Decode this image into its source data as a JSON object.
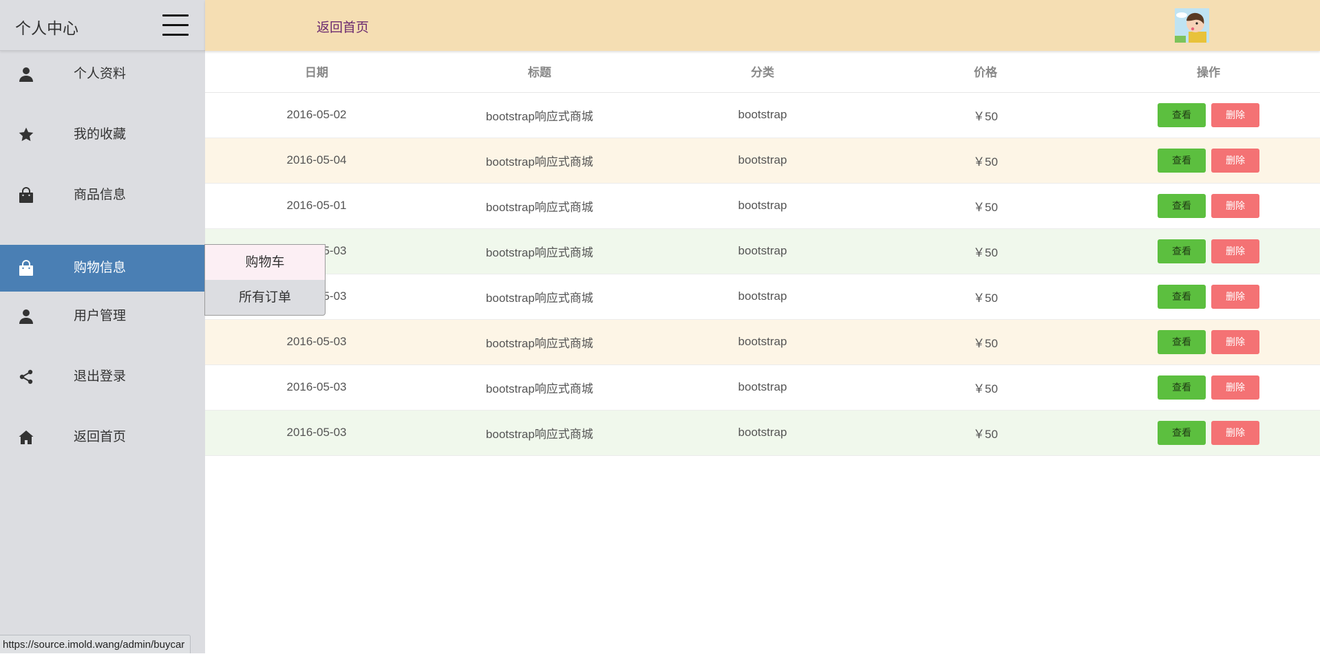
{
  "sidebar": {
    "title": "个人中心",
    "items": [
      {
        "label": "个人资料",
        "icon": "user-icon",
        "active": false
      },
      {
        "label": "我的收藏",
        "icon": "star-icon",
        "active": false
      },
      {
        "label": "商品信息",
        "icon": "shopping-bag-icon",
        "active": false
      },
      {
        "label": "购物信息",
        "icon": "shopping-bag-icon",
        "active": true
      },
      {
        "label": "用户管理",
        "icon": "user-icon",
        "active": false
      },
      {
        "label": "退出登录",
        "icon": "share-icon",
        "active": false
      },
      {
        "label": "返回首页",
        "icon": "home-icon",
        "active": false
      }
    ],
    "submenu": [
      "购物车",
      "所有订单"
    ]
  },
  "topbar": {
    "back_label": "返回首页",
    "avatar_icon": "avatar-icon"
  },
  "table": {
    "headers": [
      "日期",
      "标题",
      "分类",
      "价格",
      "操作"
    ],
    "view_label": "查看",
    "delete_label": "删除",
    "rows": [
      {
        "date": "2016-05-02",
        "title": "bootstrap响应式商城",
        "category": "bootstrap",
        "price": "￥50"
      },
      {
        "date": "2016-05-04",
        "title": "bootstrap响应式商城",
        "category": "bootstrap",
        "price": "￥50"
      },
      {
        "date": "2016-05-01",
        "title": "bootstrap响应式商城",
        "category": "bootstrap",
        "price": "￥50"
      },
      {
        "date": "2016-05-03",
        "title": "bootstrap响应式商城",
        "category": "bootstrap",
        "price": "￥50"
      },
      {
        "date": "2016-05-03",
        "title": "bootstrap响应式商城",
        "category": "bootstrap",
        "price": "￥50"
      },
      {
        "date": "2016-05-03",
        "title": "bootstrap响应式商城",
        "category": "bootstrap",
        "price": "￥50"
      },
      {
        "date": "2016-05-03",
        "title": "bootstrap响应式商城",
        "category": "bootstrap",
        "price": "￥50"
      },
      {
        "date": "2016-05-03",
        "title": "bootstrap响应式商城",
        "category": "bootstrap",
        "price": "￥50"
      }
    ],
    "row_colors": [
      "#ffffff",
      "#fdf5e6",
      "#ffffff",
      "#f0f8ec",
      "#ffffff",
      "#fdf5e6",
      "#ffffff",
      "#f0f8ec"
    ]
  },
  "statusbar": {
    "url": "https://source.imold.wang/admin/buycar"
  },
  "colors": {
    "sidebar_bg": "#dcdde1",
    "active_item": "#4a7fb4",
    "topbar_bg": "#f5deb3",
    "view_button": "#5cbf3f",
    "delete_button": "#f47274"
  }
}
